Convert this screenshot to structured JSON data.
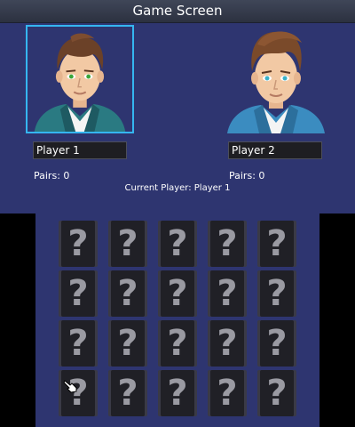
{
  "screen": {
    "title": "Game Screen"
  },
  "players": [
    {
      "name": "Player 1",
      "pairs_label": "Pairs: 0",
      "eye_color": "#3aa63a"
    },
    {
      "name": "Player 2",
      "pairs_label": "Pairs: 0",
      "eye_color": "#3ab0c8"
    }
  ],
  "status": {
    "current_player": "Current Player: Player 1"
  },
  "board": {
    "rows": 4,
    "cols": 5,
    "card_back_symbol": "?",
    "cards": [
      "?",
      "?",
      "?",
      "?",
      "?",
      "?",
      "?",
      "?",
      "?",
      "?",
      "?",
      "?",
      "?",
      "?",
      "?",
      "?",
      "?",
      "?",
      "?",
      "?"
    ]
  },
  "colors": {
    "background": "#2e3570",
    "selected_border": "#35b6f0",
    "card_back": "#202026"
  },
  "icons": {
    "cursor": "hand-pointer-icon",
    "card_back": "question-mark-icon"
  }
}
